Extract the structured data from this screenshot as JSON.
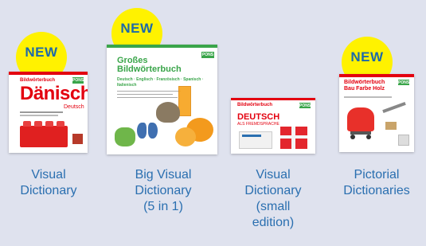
{
  "products": [
    {
      "badge": "NEW",
      "caption_lines": [
        "Visual",
        "Dictionary"
      ],
      "cover": {
        "series": "Bildwörterbuch",
        "title": "Dänisch",
        "subtitle": "Deutsch",
        "publisher": "PONS"
      }
    },
    {
      "badge": "NEW",
      "caption_lines": [
        "Big Visual",
        "Dictionary",
        "(5 in 1)"
      ],
      "cover": {
        "title_line1": "Großes",
        "title_line2": "Bildwörterbuch",
        "languages": "Deutsch · Englisch · Französisch · Spanisch · Italienisch",
        "publisher": "PONS"
      }
    },
    {
      "badge": "",
      "caption_lines": [
        "Visual",
        "Dictionary",
        "(small",
        "edition)"
      ],
      "cover": {
        "series": "Bildwörterbuch",
        "title": "DEUTSCH",
        "subtitle": "ALS FREMDSPRACHE",
        "publisher": "PONS"
      }
    },
    {
      "badge": "NEW",
      "caption_lines": [
        "Pictorial",
        "Dictionaries"
      ],
      "cover": {
        "title_line1": "Bildwörterbuch",
        "title_line2": "Bau Farbe Holz",
        "publisher": "PONS"
      }
    }
  ]
}
